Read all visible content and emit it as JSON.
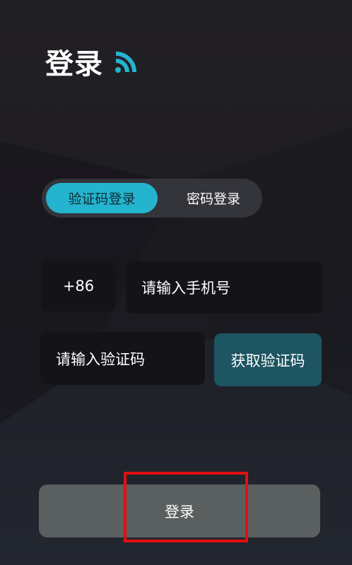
{
  "header": {
    "title": "登录",
    "icon": "signal-waves-icon",
    "accent": "#24b4cf"
  },
  "tabs": [
    {
      "label": "验证码登录",
      "active": true
    },
    {
      "label": "密码登录",
      "active": false
    }
  ],
  "form": {
    "country_code": "+86",
    "phone_placeholder": "请输入手机号",
    "code_placeholder": "请输入验证码",
    "get_code_label": "获取验证码"
  },
  "login_button": {
    "label": "登录"
  }
}
